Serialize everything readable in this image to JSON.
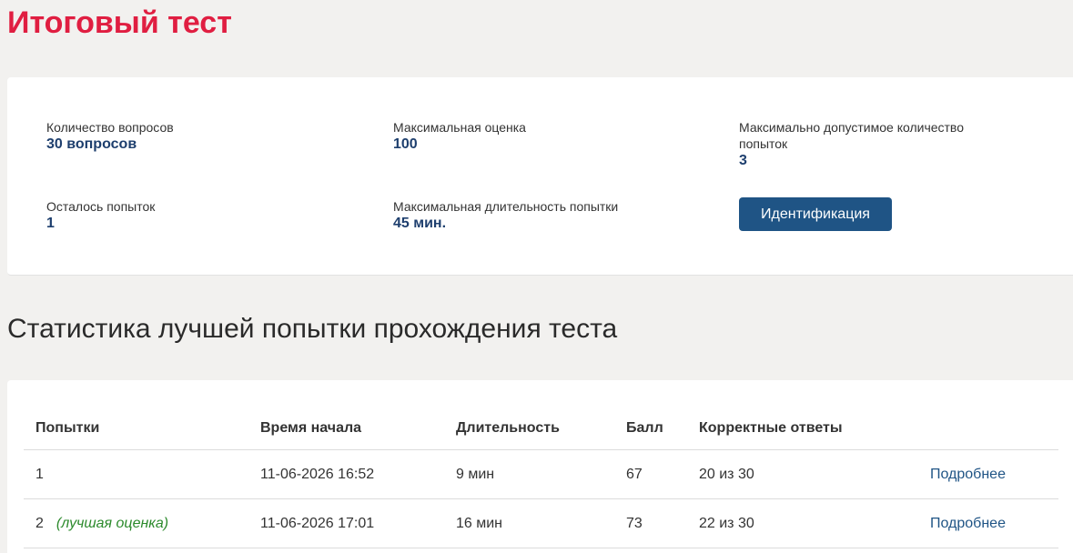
{
  "page": {
    "title": "Итоговый тест"
  },
  "info": {
    "questions_label": "Количество вопросов",
    "questions_value": "30 вопросов",
    "max_score_label": "Максимальная оценка",
    "max_score_value": "100",
    "max_attempts_label": "Максимально допустимое количество попыток",
    "max_attempts_value": "3",
    "remaining_label": "Осталось попыток",
    "remaining_value": "1",
    "max_duration_label": "Максимальная длительность попытки",
    "max_duration_value": "45 мин.",
    "ident_button": "Идентификация"
  },
  "stats": {
    "title": "Статистика лучшей попытки прохождения теста",
    "headers": {
      "attempts": "Попытки",
      "start_time": "Время начала",
      "duration": "Длительность",
      "score": "Балл",
      "correct": "Корректные ответы"
    },
    "rows": [
      {
        "number": "1",
        "note": "",
        "start": "11-06-2026 16:52",
        "duration": "9 мин",
        "score": "67",
        "correct": "20 из 30",
        "link": "Подробнее"
      },
      {
        "number": "2",
        "note": "(лучшая оценка)",
        "start": "11-06-2026 17:01",
        "duration": "16 мин",
        "score": "73",
        "correct": "22 из 30",
        "link": "Подробнее"
      }
    ]
  },
  "colors": {
    "title_red": "#e01e41",
    "value_blue": "#1e3f6e",
    "button_blue": "#1f5485",
    "best_green": "#2c8a2c"
  }
}
